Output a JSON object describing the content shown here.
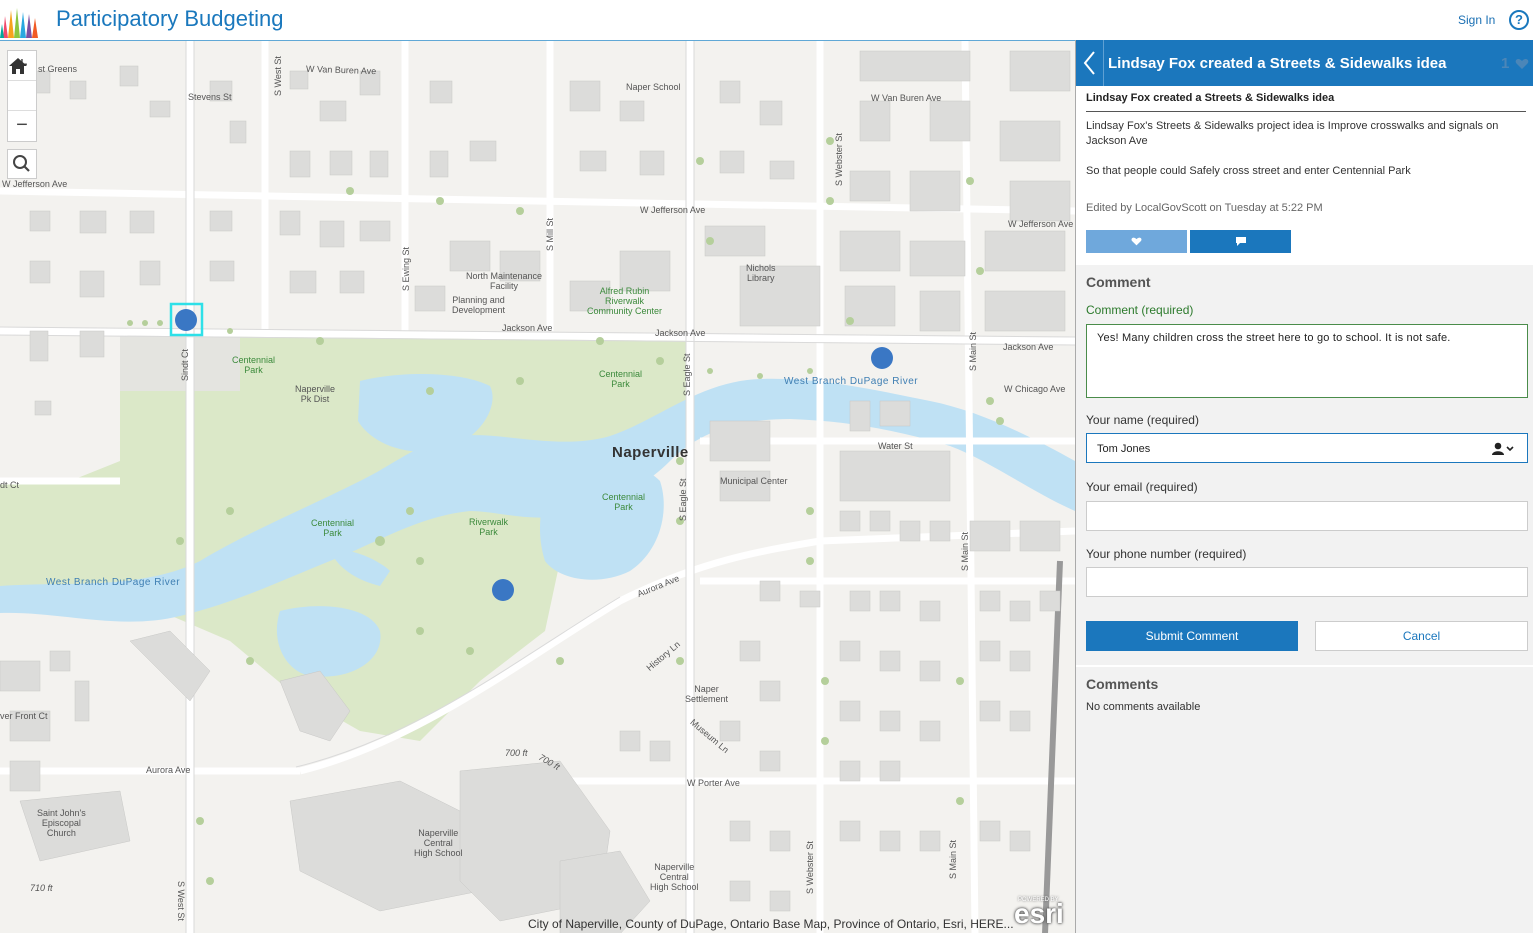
{
  "header": {
    "title": "Participatory Budgeting",
    "sign_in": "Sign In",
    "help": "?"
  },
  "map": {
    "attribution": "City of Naperville, County of DuPage, Ontario Base Map, Province of Ontario, Esri, HERE...",
    "esri_logo": "esri",
    "esri_powered": "POWERED BY",
    "zoom_in": "+",
    "zoom_out": "−",
    "labels": {
      "greens": "st Greens",
      "w_van_buren_1": "W Van Buren Ave",
      "w_van_buren_2": "W Van Buren Ave",
      "stevens": "Stevens St",
      "w_jefferson_1": "W Jefferson Ave",
      "w_jefferson_2": "W Jefferson Ave",
      "w_jefferson_3": "W Jefferson Ave",
      "naper_school": "Naper School",
      "north_maint": "North Maintenance\nFacility",
      "planning": "Planning and\nDevelopment",
      "alfred_rubin": "Alfred Rubin\nRiverwalk\nCommunity Center",
      "nichols": "Nichols\nLibrary",
      "jackson_1": "Jackson Ave",
      "jackson_2": "Jackson Ave",
      "jackson_3": "Jackson Ave",
      "centennial_park_1": "Centennial\nPark",
      "centennial_park_2": "Centennial\nPark",
      "centennial_park_3": "Centennial\nPark",
      "centennial_park_4": "Centennial\nPark",
      "naperville_pk": "Naperville\nPk Dist",
      "naperville": "Naperville",
      "west_branch_1": "West Branch DuPage River",
      "west_branch_2": "West Branch DuPage River",
      "w_chicago": "W Chicago Ave",
      "water_st": "Water St",
      "municipal": "Municipal Center",
      "riverwalk_park": "Riverwalk\nPark",
      "aurora_1": "Aurora Ave",
      "aurora_2": "Aurora Ave",
      "history_ln": "History Ln",
      "naper_settlement": "Naper\nSettlement",
      "museum_ln": "Museum Ln",
      "w_porter": "W Porter Ave",
      "st_johns": "Saint John's\nEpiscopal\nChurch",
      "naperville_central_1": "Naperville\nCentral\nHigh School",
      "naperville_central_2": "Naperville\nCentral\nHigh School",
      "ft_700_1": "700 ft",
      "ft_700_2": "700 ft",
      "ft_710": "710 ft",
      "river_front": "ver Front Ct",
      "dt_ct": "dt Ct",
      "w_west_st_1": "S West St",
      "w_west_st_2": "S West St",
      "ewing": "S Ewing St",
      "mill": "S Mill St",
      "sindt": "Sindt Ct",
      "eagle_1": "S Eagle St",
      "eagle_2": "S Eagle St",
      "webster_1": "S Webster St",
      "webster_2": "S Webster St",
      "main_1": "S Main St",
      "main_2": "S Main St",
      "main_3": "S Main St"
    }
  },
  "panel": {
    "title": "Lindsay Fox created a Streets & Sidewalks idea",
    "vote_count": "1",
    "idea_heading": "Lindsay Fox created a Streets & Sidewalks idea",
    "description": "Lindsay Fox's Streets & Sidewalks project idea is Improve crosswalks and signals on Jackson Ave",
    "reason": "So that people could Safely cross street and enter Centennial Park",
    "edited": "Edited by LocalGovScott on Tuesday at 5:22 PM",
    "comment_section_title": "Comment",
    "comment_label": "Comment (required)",
    "comment_value": "Yes! Many children cross the street here to go to school.  It is not safe.",
    "name_label": "Your name (required)",
    "name_value": "Tom Jones",
    "email_label": "Your email (required)",
    "email_value": "",
    "phone_label": "Your phone number (required)",
    "phone_value": "",
    "submit": "Submit Comment",
    "cancel": "Cancel",
    "comments_title": "Comments",
    "no_comments": "No comments available"
  },
  "colors": {
    "brand_blue": "#1b77bd",
    "like_blue": "#6fa8dc",
    "water": "#bfe1f4",
    "park": "#dbe8c8",
    "point": "#3a77c4",
    "selection": "#2ee0e8"
  }
}
